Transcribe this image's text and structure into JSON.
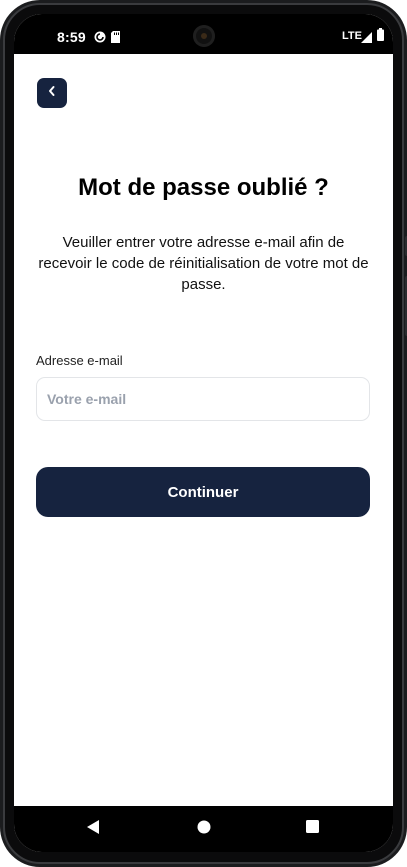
{
  "status_bar": {
    "time": "8:59",
    "network": "LTE",
    "icons": [
      "pocket-casts-icon",
      "sd-card-icon",
      "camera-icon",
      "signal-icon",
      "battery-icon"
    ]
  },
  "header": {
    "back_icon": "chevron-left-icon"
  },
  "main": {
    "title": "Mot de passe oublié ?",
    "subtitle": "Veuiller entrer votre adresse e-mail afin de recevoir le code de réinitialisation de votre mot de passe.",
    "email_label": "Adresse e-mail",
    "email_placeholder": "Votre e-mail",
    "email_value": "",
    "continue_label": "Continuer"
  },
  "nav_bar": {
    "icons": [
      "back-triangle-icon",
      "home-circle-icon",
      "recents-square-icon"
    ]
  },
  "colors": {
    "primary": "#16233f",
    "background": "#ffffff",
    "placeholder": "#9aa1ad",
    "input_border": "#e3e5e8"
  }
}
